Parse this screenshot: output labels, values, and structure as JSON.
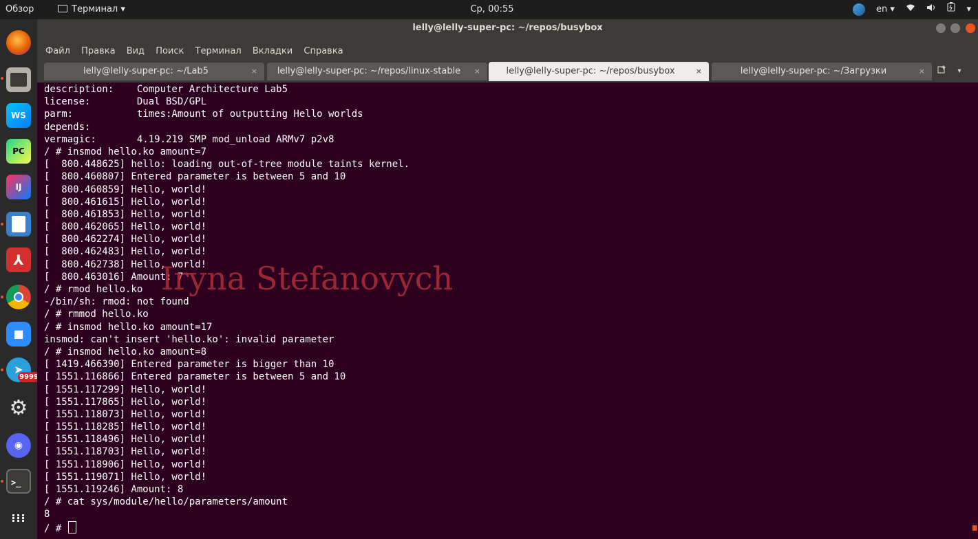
{
  "topbar": {
    "overview": "Обзор",
    "app_name": "Терминал ▾",
    "clock": "Ср, 00:55",
    "lang": "en ▾",
    "status_icons": [
      "wifi-icon",
      "volume-icon",
      "battery-icon",
      "chevron-down-icon"
    ]
  },
  "dock": {
    "items": [
      {
        "name": "firefox-icon",
        "label": "",
        "color": "#e66000"
      },
      {
        "name": "files-icon",
        "label": "",
        "color": "#b5b0a6"
      },
      {
        "name": "webstorm-icon",
        "label": "WS",
        "color": "#07c3f2"
      },
      {
        "name": "pycharm-icon",
        "label": "PC",
        "color": "#21d789"
      },
      {
        "name": "intellij-icon",
        "label": "IJ",
        "color": "#fe315d"
      },
      {
        "name": "document-viewer-icon",
        "label": "",
        "color": "#3d7fcf"
      },
      {
        "name": "pdf-reader-icon",
        "label": "",
        "color": "#d32f2f"
      },
      {
        "name": "chrome-icon",
        "label": "",
        "color": "#f4b400"
      },
      {
        "name": "zoom-icon",
        "label": "",
        "color": "#2d8cff"
      },
      {
        "name": "telegram-icon",
        "label": "",
        "color": "#2aa0da"
      },
      {
        "name": "settings-icon",
        "label": "",
        "color": "#cfcfcf"
      },
      {
        "name": "discord-icon",
        "label": "",
        "color": "#5865f2"
      },
      {
        "name": "terminal-icon",
        "label": ">_",
        "color": "#3c3b37"
      },
      {
        "name": "show-apps-icon",
        "label": "",
        "color": "#2a2a2a"
      }
    ],
    "telegram_badge": "9999"
  },
  "window": {
    "title": "lelly@lelly-super-pc: ~/repos/busybox",
    "menu": [
      "Файл",
      "Правка",
      "Вид",
      "Поиск",
      "Терминал",
      "Вкладки",
      "Справка"
    ],
    "tabs": [
      {
        "label": "lelly@lelly-super-pc: ~/Lab5",
        "active": false
      },
      {
        "label": "lelly@lelly-super-pc: ~/repos/linux-stable",
        "active": false
      },
      {
        "label": "lelly@lelly-super-pc: ~/repos/busybox",
        "active": true
      },
      {
        "label": "lelly@lelly-super-pc: ~/Загрузки",
        "active": false
      }
    ],
    "tab_close": "×"
  },
  "terminal": {
    "lines": [
      "description:    Computer Architecture Lab5",
      "license:        Dual BSD/GPL",
      "parm:           times:Amount of outputting Hello worlds",
      "depends:",
      "vermagic:       4.19.219 SMP mod_unload ARMv7 p2v8",
      "/ # insmod hello.ko amount=7",
      "[  800.448625] hello: loading out-of-tree module taints kernel.",
      "[  800.460807] Entered parameter is between 5 and 10",
      "[  800.460859] Hello, world!",
      "[  800.461615] Hello, world!",
      "[  800.461853] Hello, world!",
      "[  800.462065] Hello, world!",
      "[  800.462274] Hello, world!",
      "[  800.462483] Hello, world!",
      "[  800.462738] Hello, world!",
      "[  800.463016] Amount: 7",
      "/ # rmod hello.ko",
      "-/bin/sh: rmod: not found",
      "/ # rmmod hello.ko",
      "/ # insmod hello.ko amount=17",
      "insmod: can't insert 'hello.ko': invalid parameter",
      "/ # insmod hello.ko amount=8",
      "[ 1419.466390] Entered parameter is bigger than 10",
      "[ 1551.116866] Entered parameter is between 5 and 10",
      "[ 1551.117299] Hello, world!",
      "[ 1551.117865] Hello, world!",
      "[ 1551.118073] Hello, world!",
      "[ 1551.118285] Hello, world!",
      "[ 1551.118496] Hello, world!",
      "[ 1551.118703] Hello, world!",
      "[ 1551.118906] Hello, world!",
      "[ 1551.119071] Hello, world!",
      "[ 1551.119246] Amount: 8",
      "/ # cat sys/module/hello/parameters/amount",
      "8"
    ],
    "prompt": "/ # "
  },
  "watermark": "Iryna Stefanovych"
}
